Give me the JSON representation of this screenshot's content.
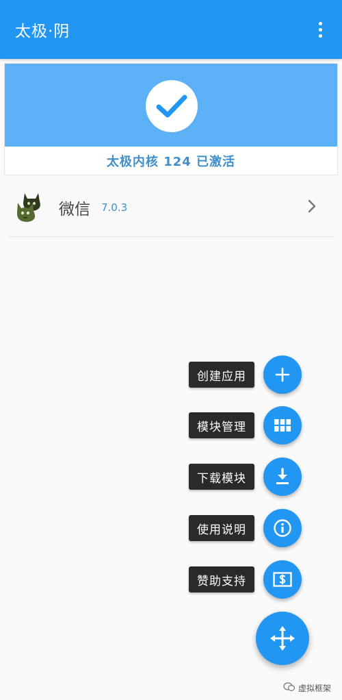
{
  "colors": {
    "primary": "#2196F3",
    "banner": "#5CB0F5",
    "accent_text": "#3F8FCB"
  },
  "appbar": {
    "title": "太极·阴",
    "menu_icon": "more-vert-icon"
  },
  "status": {
    "icon": "check-icon",
    "text": "太极内核 124 已激活"
  },
  "apps": [
    {
      "name": "微信",
      "version": "7.0.3",
      "icon": "app-icon",
      "chevron": "chevron-right-icon"
    }
  ],
  "fab_menu": [
    {
      "label": "创建应用",
      "icon": "plus-icon"
    },
    {
      "label": "模块管理",
      "icon": "grid-icon"
    },
    {
      "label": "下载模块",
      "icon": "download-icon"
    },
    {
      "label": "使用说明",
      "icon": "info-icon"
    },
    {
      "label": "赞助支持",
      "icon": "sponsor-icon"
    }
  ],
  "fab_main": {
    "icon": "move-arrows-icon"
  },
  "watermark": {
    "text": "虚拟框架"
  }
}
